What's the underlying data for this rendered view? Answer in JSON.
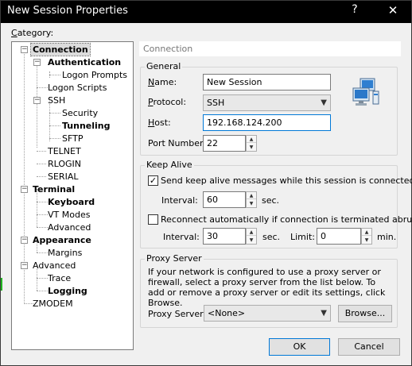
{
  "window": {
    "title": "New Session Properties",
    "help": "?",
    "close": "✕"
  },
  "category_label": "Category:",
  "tree": {
    "connection": "Connection",
    "authentication": "Authentication",
    "logon_prompts": "Logon Prompts",
    "logon_scripts": "Logon Scripts",
    "ssh": "SSH",
    "security": "Security",
    "tunneling": "Tunneling",
    "sftp": "SFTP",
    "telnet": "TELNET",
    "rlogin": "RLOGIN",
    "serial": "SERIAL",
    "terminal": "Terminal",
    "keyboard": "Keyboard",
    "vt_modes": "VT Modes",
    "advanced_term": "Advanced",
    "appearance": "Appearance",
    "margins": "Margins",
    "advanced": "Advanced",
    "trace": "Trace",
    "logging": "Logging",
    "zmodem": "ZMODEM"
  },
  "section_title": "Connection",
  "general": {
    "title": "General",
    "name_label": "Name:",
    "name_value": "New Session",
    "protocol_label": "Protocol:",
    "protocol_value": "SSH",
    "host_label": "Host:",
    "host_value": "192.168.124.200",
    "port_label": "Port Number:",
    "port_value": "22"
  },
  "keep_alive": {
    "title": "Keep Alive",
    "send_label": "Send keep alive messages while this session is connected",
    "send_checked": "✓",
    "interval1_label": "Interval:",
    "interval1_value": "60",
    "sec1": "sec.",
    "reconnect_label": "Reconnect automatically if connection is terminated abruptly",
    "interval2_label": "Interval:",
    "interval2_value": "30",
    "sec2": "sec.",
    "limit_label": "Limit:",
    "limit_value": "0",
    "min": "min."
  },
  "proxy": {
    "title": "Proxy Server",
    "description": "If your network is configured to use a proxy server or firewall, select a proxy server from the list below. To add or remove a proxy server or edit its settings, click Browse.",
    "server_label": "Proxy Server:",
    "server_value": "<None>",
    "browse": "Browse..."
  },
  "buttons": {
    "ok": "OK",
    "cancel": "Cancel"
  },
  "icons": {
    "connection_icon": "network-computers-icon"
  }
}
